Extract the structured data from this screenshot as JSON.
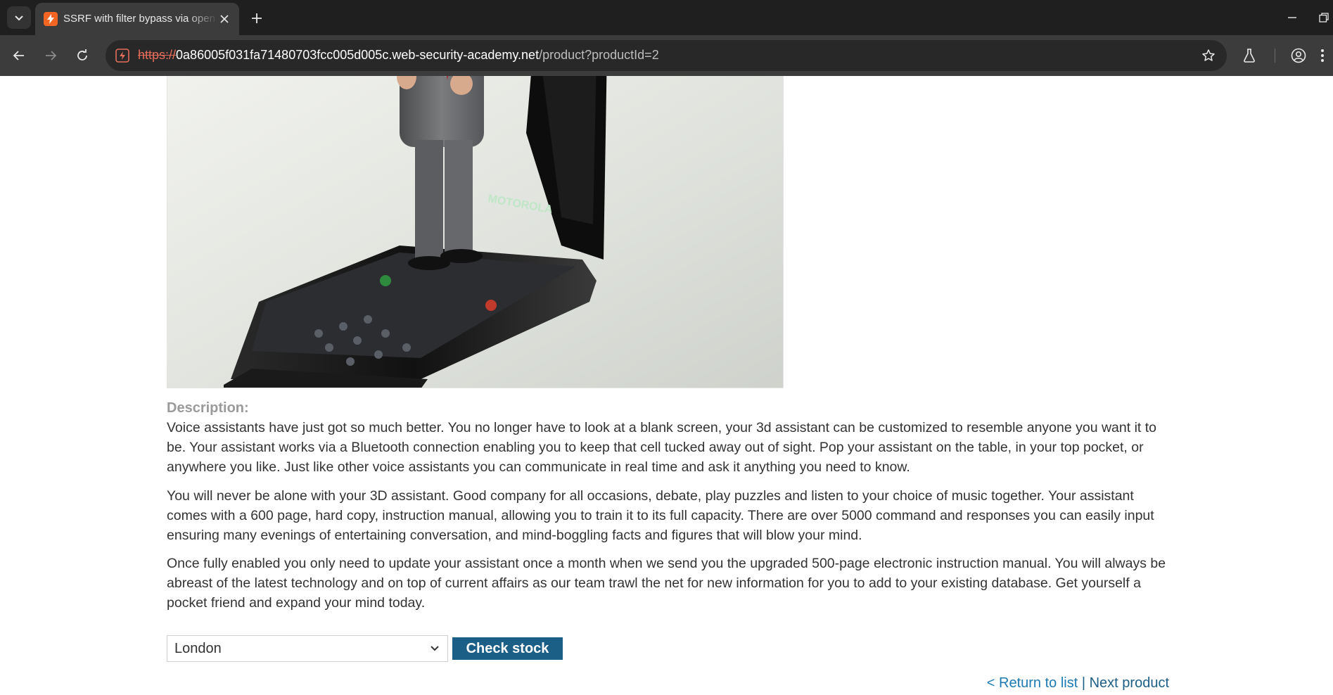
{
  "browser": {
    "tab_title": "SSRF with filter bypass via open redirection vulnerability",
    "url_scheme": "https://",
    "url_host": "0a86005f031fa71480703fcc005d005c.web-security-academy.net",
    "url_path": "/product?productId=2"
  },
  "product": {
    "image_text": "MOTOROLA",
    "description_label": "Description:",
    "paragraphs": [
      "Voice assistants have just got so much better. You no longer have to look at a blank screen, your 3d assistant can be customized to resemble anyone you want it to be. Your assistant works via a Bluetooth connection enabling you to keep that cell tucked away out of sight. Pop your assistant on the table, in your top pocket, or anywhere you like. Just like other voice assistants you can communicate in real time and ask it anything you need to know.",
      "You will never be alone with your 3D assistant. Good company for all occasions, debate, play puzzles and listen to your choice of music together. Your assistant comes with a 600 page, hard copy, instruction manual, allowing you to train it to its full capacity. There are over 5000 command and responses you can easily input ensuring many evenings of entertaining conversation, and mind-boggling facts and figures that will blow your mind.",
      "Once fully enabled you only need to update your assistant once a month when we send you the upgraded 500-page electronic instruction manual. You will always be abreast of the latest technology and on top of current affairs as our team trawl the net for new information for you to add to your existing database. Get yourself a pocket friend and expand your mind today."
    ]
  },
  "stock_check": {
    "selected_store": "London",
    "button_label": "Check stock"
  },
  "nav_links": {
    "return": "< Return to list",
    "separator": "|",
    "next": "Next product"
  },
  "colors": {
    "accent": "#1c5f86",
    "chrome_dark": "#1f1f1f",
    "chrome_toolbar": "#3c3c3c"
  }
}
